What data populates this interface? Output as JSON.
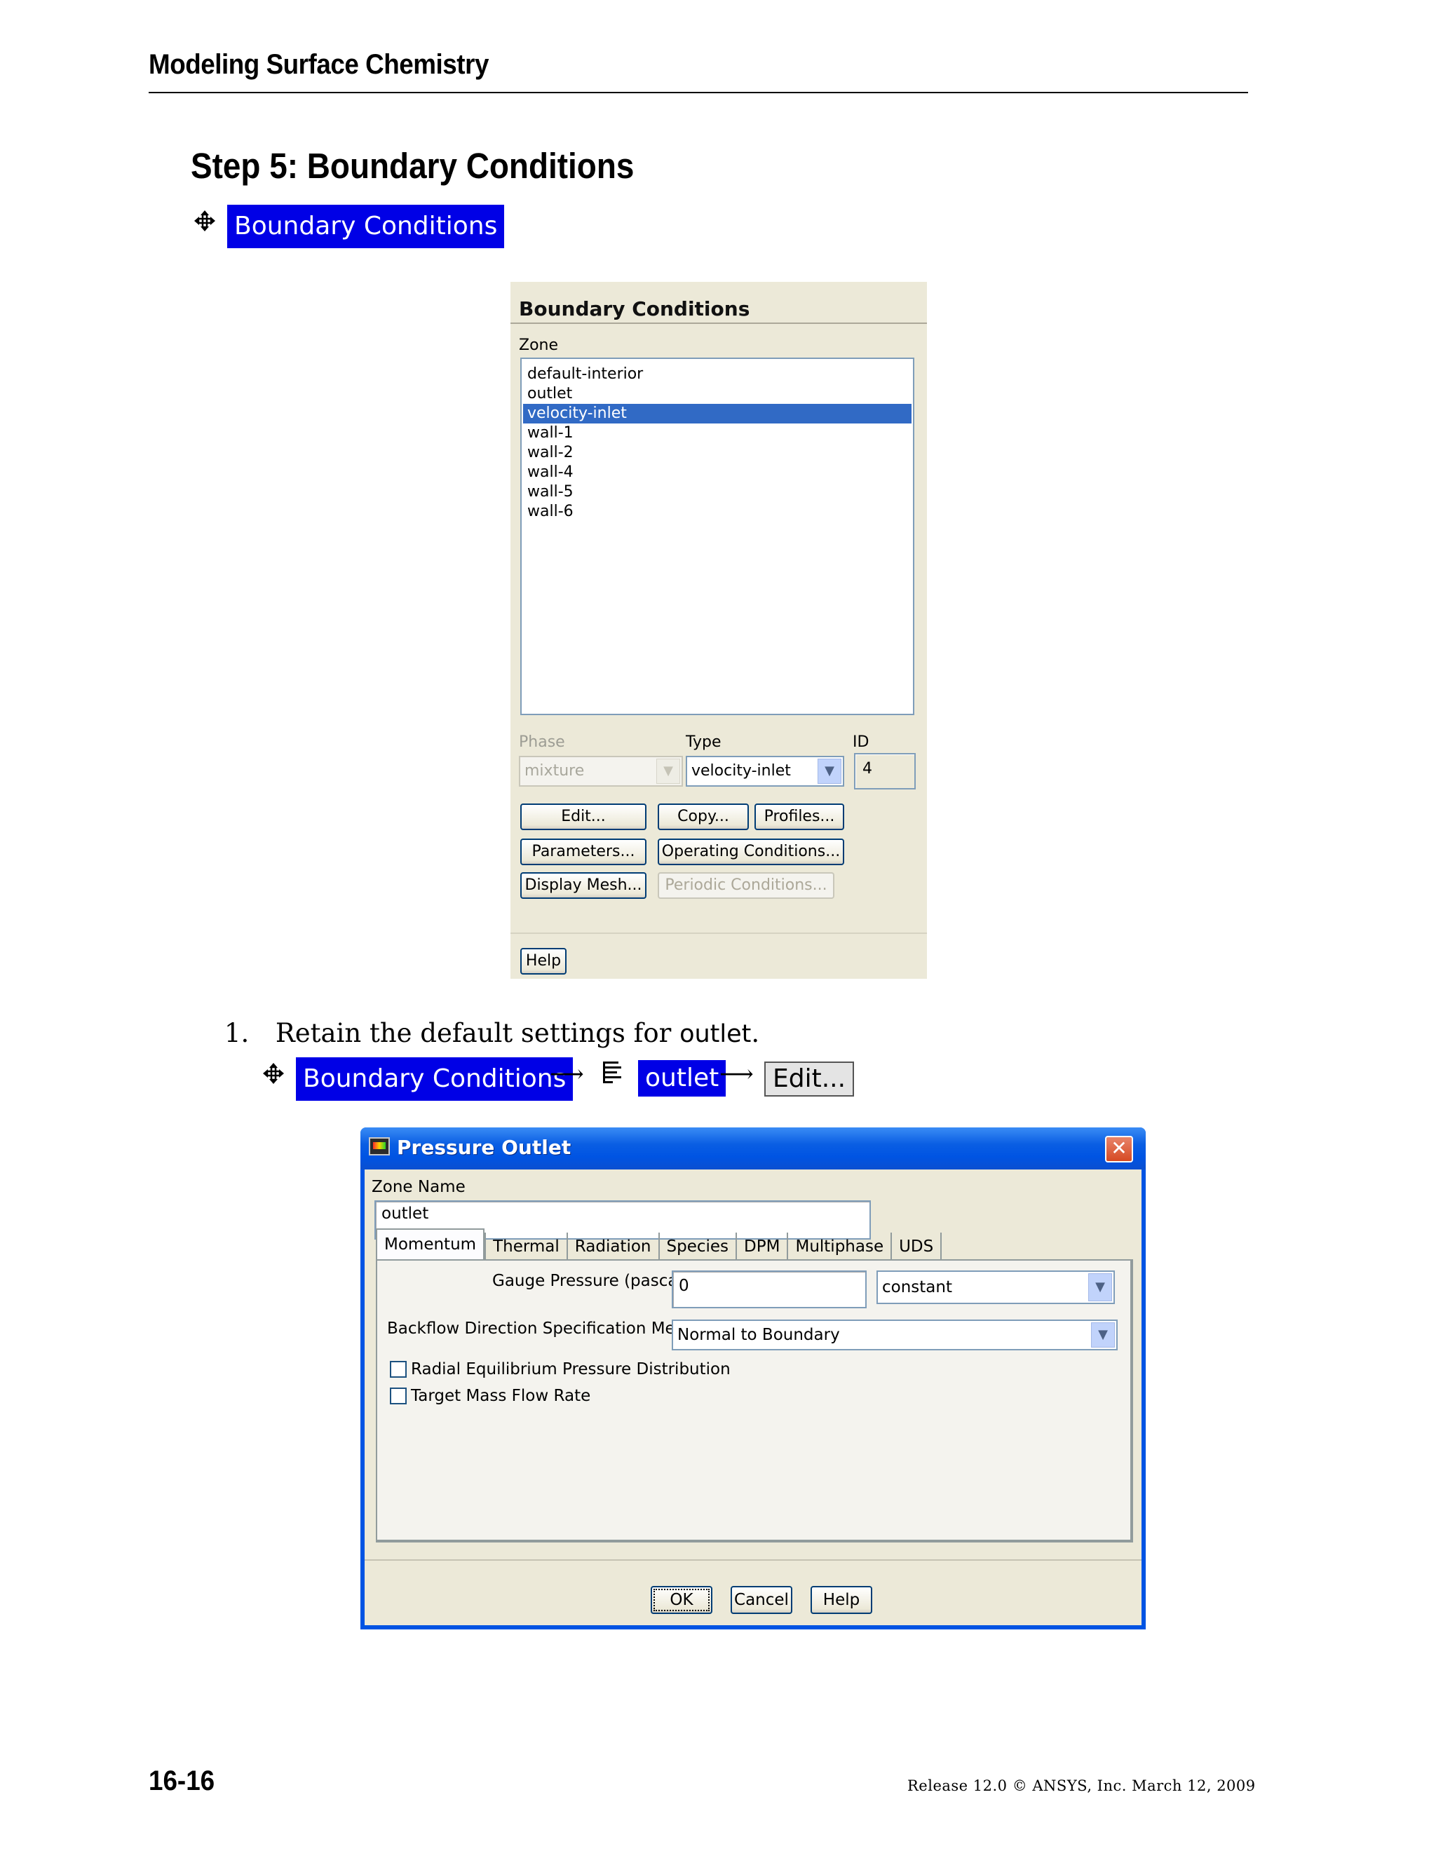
{
  "page_header": {
    "title": "Modeling Surface Chemistry"
  },
  "section": {
    "title": "Step 5: Boundary Conditions"
  },
  "nav_path_1": {
    "label": "Boundary Conditions"
  },
  "bc_panel": {
    "title": "Boundary Conditions",
    "zone_label": "Zone",
    "zones": [
      "default-interior",
      "outlet",
      "velocity-inlet",
      "wall-1",
      "wall-2",
      "wall-4",
      "wall-5",
      "wall-6"
    ],
    "selected_zone": "velocity-inlet",
    "phase_label": "Phase",
    "phase_value": "mixture",
    "type_label": "Type",
    "type_value": "velocity-inlet",
    "id_label": "ID",
    "id_value": "4",
    "buttons": {
      "edit": "Edit...",
      "copy": "Copy...",
      "profiles": "Profiles...",
      "parameters": "Parameters...",
      "operating_conditions": "Operating Conditions...",
      "display_mesh": "Display Mesh...",
      "periodic_conditions": "Periodic Conditions...",
      "help": "Help"
    }
  },
  "step_item": {
    "number": "1.",
    "text_before": "Retain the default settings for",
    "code": "outlet",
    "text_after": "."
  },
  "nav_path_2": {
    "panel": "Boundary Conditions",
    "arrow": "⟶",
    "zone": "outlet",
    "action": "Edit..."
  },
  "pressure_outlet": {
    "title": "Pressure Outlet",
    "close_glyph": "✕",
    "zone_name_label": "Zone Name",
    "zone_name_value": "outlet",
    "tabs": [
      "Momentum",
      "Thermal",
      "Radiation",
      "Species",
      "DPM",
      "Multiphase",
      "UDS"
    ],
    "active_tab": "Momentum",
    "gauge_pressure_label": "Gauge Pressure (pascal)",
    "gauge_pressure_value": "0",
    "gauge_pressure_method": "constant",
    "backflow_label": "Backflow Direction Specification Method",
    "backflow_value": "Normal to Boundary",
    "checkboxes": [
      {
        "label": "Radial Equilibrium Pressure Distribution",
        "checked": false
      },
      {
        "label": "Target Mass Flow Rate",
        "checked": false
      }
    ],
    "buttons": {
      "ok": "OK",
      "cancel": "Cancel",
      "help": "Help"
    }
  },
  "footer": {
    "page_number": "16-16",
    "release": "Release 12.0 © ANSYS, Inc. March 12, 2009"
  },
  "colors": {
    "nav_highlight": "#0000e6",
    "xp_title_blue": "#0054e3",
    "selection_blue": "#316ac5",
    "panel_beige": "#ece9d8"
  }
}
